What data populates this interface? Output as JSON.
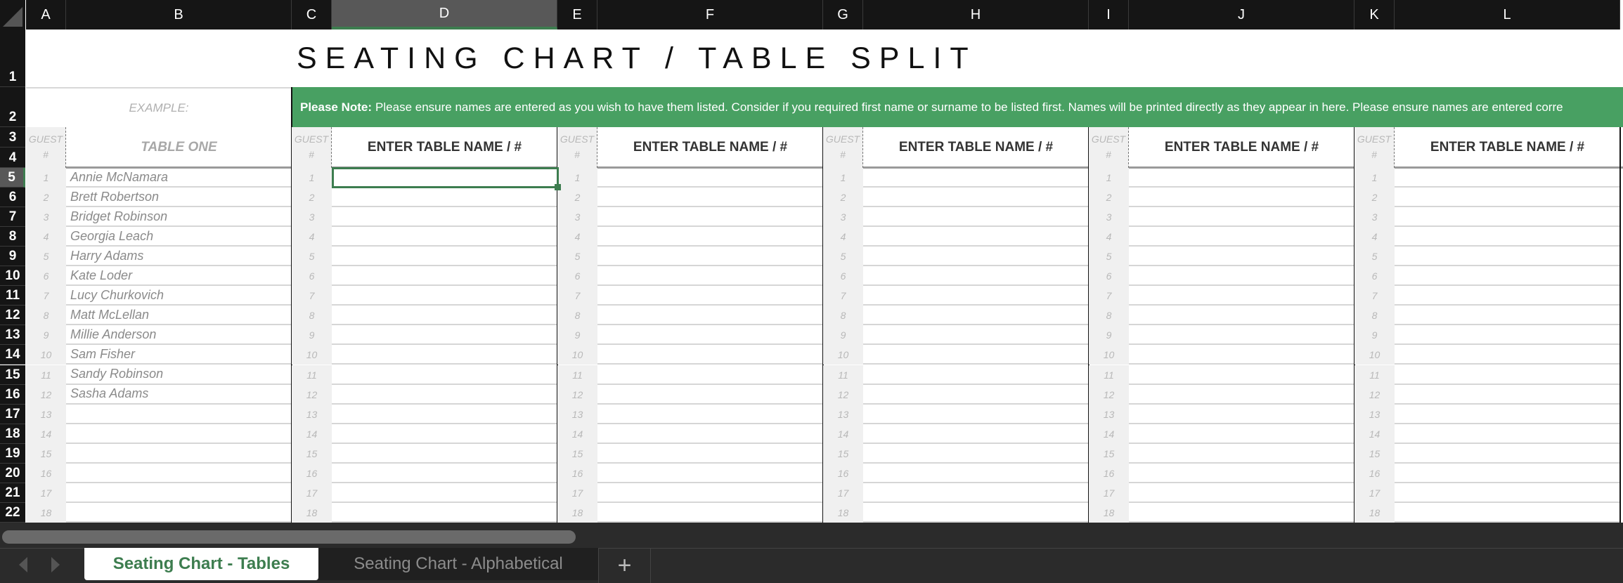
{
  "columns": [
    "A",
    "B",
    "C",
    "D",
    "E",
    "F",
    "G",
    "H",
    "I",
    "J",
    "K",
    "L"
  ],
  "selected_column": "D",
  "selected_row": 5,
  "rows": [
    1,
    2,
    3,
    4,
    5,
    6,
    7,
    8,
    9,
    10,
    11,
    12,
    13,
    14,
    15,
    16,
    17,
    18,
    19,
    20,
    21,
    22
  ],
  "title": "SEATING CHART / TABLE SPLIT",
  "example_label": "EXAMPLE:",
  "note": {
    "label": "Please Note:",
    "text": "Please ensure names are entered as you wish to have them listed. Consider if you required first name or surname to be listed first. Names will be printed directly as they appear in here. Please ensure names are entered corre"
  },
  "guest_header": {
    "line1": "GUEST",
    "line2": "#"
  },
  "guest_numbers": [
    "1",
    "2",
    "3",
    "4",
    "5",
    "6",
    "7",
    "8",
    "9",
    "10",
    "11",
    "12",
    "13",
    "14",
    "15",
    "16",
    "17",
    "18"
  ],
  "tables": [
    {
      "name": "TABLE ONE",
      "example": true,
      "guests": [
        "Annie McNamara",
        "Brett Robertson",
        "Bridget Robinson",
        "Georgia Leach",
        "Harry Adams",
        "Kate Loder",
        "Lucy Churkovich",
        "Matt McLellan",
        "Millie Anderson",
        "Sam Fisher",
        "Sandy Robinson",
        "Sasha Adams"
      ]
    },
    {
      "name": "ENTER TABLE NAME / #",
      "example": false,
      "guests": []
    },
    {
      "name": "ENTER TABLE NAME / #",
      "example": false,
      "guests": []
    },
    {
      "name": "ENTER TABLE NAME / #",
      "example": false,
      "guests": []
    },
    {
      "name": "ENTER TABLE NAME / #",
      "example": false,
      "guests": []
    },
    {
      "name": "ENTER TABLE NAME / #",
      "example": false,
      "guests": []
    }
  ],
  "sheet_tabs": [
    {
      "label": "Seating Chart - Tables",
      "active": true
    },
    {
      "label": "Seating Chart - Alphabetical",
      "active": false
    }
  ],
  "add_sheet_label": "+",
  "colors": {
    "accent": "#3d7d4f",
    "note_bg": "#48a062"
  }
}
